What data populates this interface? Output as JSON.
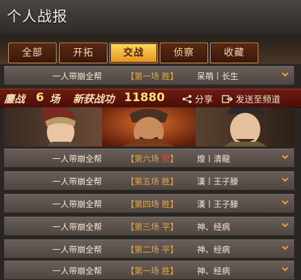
{
  "header": {
    "title": "个人战报"
  },
  "tabs": [
    {
      "label": "全部",
      "active": false
    },
    {
      "label": "开拓",
      "active": false
    },
    {
      "label": "交战",
      "active": true
    },
    {
      "label": "侦察",
      "active": false
    },
    {
      "label": "收藏",
      "active": false
    }
  ],
  "first_report": {
    "title": "一人带崩全帮",
    "game": "【第一场 胜】",
    "opponents": "呆萌丨长生"
  },
  "summary": {
    "prefix": "鏖战",
    "count": "6",
    "unit": "场",
    "merit_label": "新获战功",
    "merit_value": "11880",
    "share_label": "分享",
    "send_label": "发送至频道"
  },
  "portraits": [
    {
      "name": "hero-portrait-left"
    },
    {
      "name": "hero-portrait-center"
    },
    {
      "name": "hero-portrait-right"
    }
  ],
  "reports": [
    {
      "title": "一人带崩全帮",
      "game_open": "【第六场 ",
      "result": "败",
      "game_close": "】",
      "lose": true,
      "opponents": "煌丨清龍"
    },
    {
      "title": "一人带崩全帮",
      "game_open": "【第五场 ",
      "result": "胜",
      "game_close": "】",
      "lose": false,
      "opponents": "漢丨王子滕"
    },
    {
      "title": "一人带崩全帮",
      "game_open": "【第四场 ",
      "result": "胜",
      "game_close": "】",
      "lose": false,
      "opponents": "漢丨王子滕"
    },
    {
      "title": "一人带崩全帮",
      "game_open": "【第三场 ",
      "result": "平",
      "game_close": "】",
      "lose": false,
      "opponents": "神、经病"
    },
    {
      "title": "一人带崩全帮",
      "game_open": "【第二场 ",
      "result": "平",
      "game_close": "】",
      "lose": false,
      "opponents": "神、经病"
    },
    {
      "title": "一人带崩全帮",
      "game_open": "【第一场 ",
      "result": "胜",
      "game_close": "】",
      "lose": false,
      "opponents": "神、经病"
    }
  ],
  "colors": {
    "accent_gold": "#e8a53f",
    "lose_red": "#ef4432",
    "tab_active": "#ffd95e"
  }
}
